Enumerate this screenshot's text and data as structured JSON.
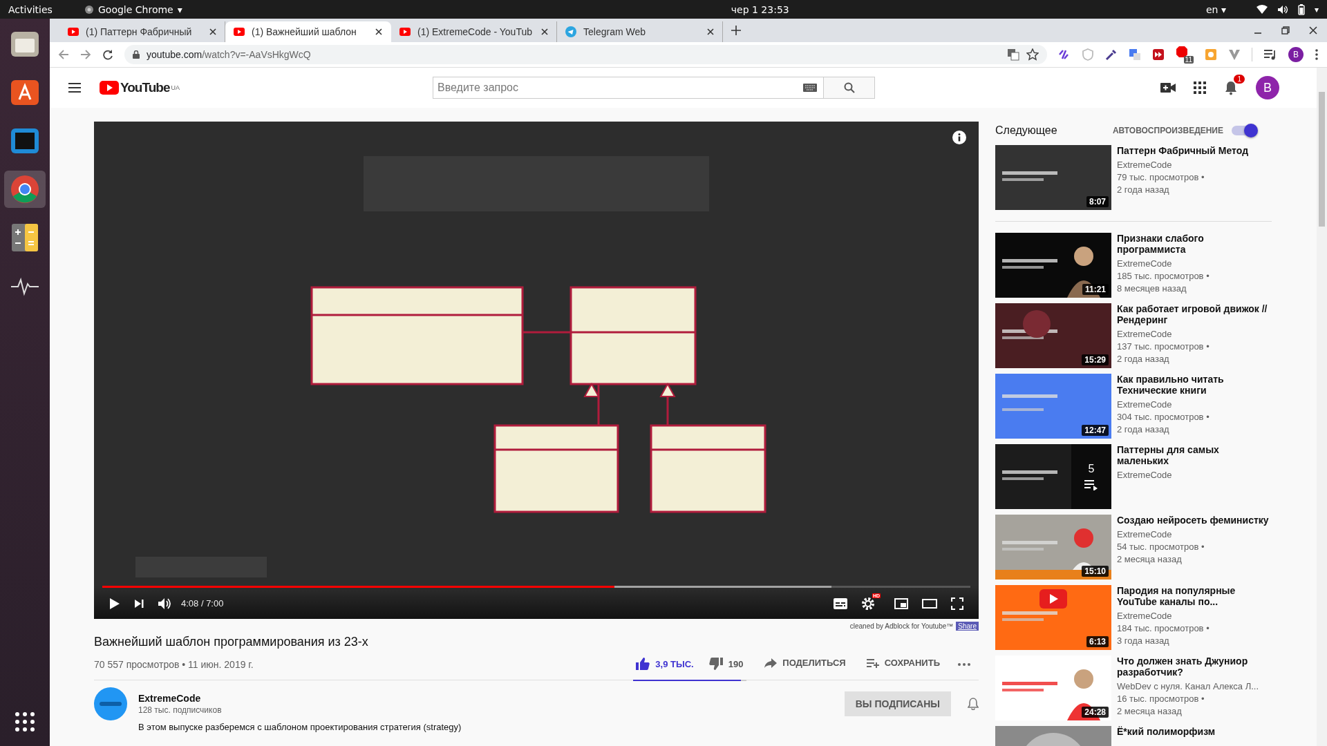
{
  "system_bar": {
    "activities": "Activities",
    "app_name": "Google Chrome",
    "clock": "чер 1  23:53",
    "language": "en",
    "menu_caret": "▾"
  },
  "dock": [
    {
      "kind": "files",
      "selected": false
    },
    {
      "kind": "store",
      "selected": false
    },
    {
      "kind": "webstorm",
      "selected": false
    },
    {
      "kind": "chrome",
      "selected": true
    },
    {
      "kind": "calculator",
      "selected": false
    },
    {
      "kind": "monitor",
      "selected": false
    }
  ],
  "tabs": [
    {
      "kind": "youtube",
      "title": "(1) Паттерн Фабричный",
      "selected": false
    },
    {
      "kind": "youtube",
      "title": "(1) Важнейший шаблон",
      "selected": true
    },
    {
      "kind": "youtube",
      "title": "(1) ExtremeCode - YouTub",
      "selected": false
    },
    {
      "kind": "telegram",
      "title": "Telegram Web",
      "selected": false
    }
  ],
  "address": {
    "host": "youtube.com",
    "path": "/watch?v=-AaVsHkgWcQ"
  },
  "extensions": {
    "badge": "11",
    "profile": "B"
  },
  "header": {
    "logo": "YouTube",
    "country": "UA",
    "search_placeholder": "Введите запрос",
    "notifications": "1",
    "avatar": "B"
  },
  "player": {
    "time": "4:08 / 7:00",
    "progress": {
      "level": 0.59
    },
    "buffer": {
      "level": 0.84
    },
    "hd": "HD"
  },
  "adblock": {
    "note": "cleaned by Adblock for Youtube™",
    "share": "Share"
  },
  "video": {
    "title": "Важнейший шаблон программирования из 23-х",
    "meta": "70 557 просмотров • 11 июн. 2019 г.",
    "likes": "3,9 ТЫС.",
    "dislikes": "190",
    "share": "ПОДЕЛИТЬСЯ",
    "save": "СОХРАНИТЬ",
    "sentiment": {
      "level": 0.95
    }
  },
  "channel": {
    "name": "ExtremeCode",
    "subscribers": "128 тыс. подписчиков",
    "subscribe": "ВЫ ПОДПИСАНЫ",
    "description": "В этом выпуске разберемся с шаблоном проектирования стратегия (strategy)"
  },
  "sidebar": {
    "heading": "Следующее",
    "autoplay_label": "АВТОВОСПРОИЗВЕДЕНИЕ",
    "autoplay": true,
    "items": [
      {
        "kind": "video",
        "title": "Паттерн Фабричный Метод",
        "channel": "ExtremeCode",
        "views": "79 тыс. просмотров •",
        "age": "2 года назад",
        "duration": "8:07"
      },
      {
        "kind": "video",
        "title": "Признаки слабого программиста",
        "channel": "ExtremeCode",
        "views": "185 тыс. просмотров •",
        "age": "8 месяцев назад",
        "duration": "11:21"
      },
      {
        "kind": "video",
        "title": "Как работает игровой движок // Рендеринг",
        "channel": "ExtremeCode",
        "views": "137 тыс. просмотров •",
        "age": "2 года назад",
        "duration": "15:29"
      },
      {
        "kind": "video",
        "title": "Как правильно читать Технические книги",
        "channel": "ExtremeCode",
        "views": "304 тыс. просмотров •",
        "age": "2 года назад",
        "duration": "12:47"
      },
      {
        "kind": "playlist",
        "title": "Паттерны для самых маленьких",
        "channel": "ExtremeCode",
        "count": "5"
      },
      {
        "kind": "video",
        "title": "Создаю нейросеть феминистку",
        "channel": "ExtremeCode",
        "views": "54 тыс. просмотров •",
        "age": "2 месяца назад",
        "duration": "15:10"
      },
      {
        "kind": "video",
        "title": "Пародия на популярные YouTube каналы по...",
        "channel": "ExtremeCode",
        "views": "184 тыс. просмотров •",
        "age": "3 года назад",
        "duration": "6:13"
      },
      {
        "kind": "video",
        "title": "Что должен знать Джуниор разработчик?",
        "channel": "WebDev с нуля. Канал Алекса Л...",
        "views": "16 тыс. просмотров •",
        "age": "2 месяца назад",
        "duration": "24:28"
      },
      {
        "kind": "video",
        "title": "Ё*кий полиморфизм"
      }
    ]
  }
}
